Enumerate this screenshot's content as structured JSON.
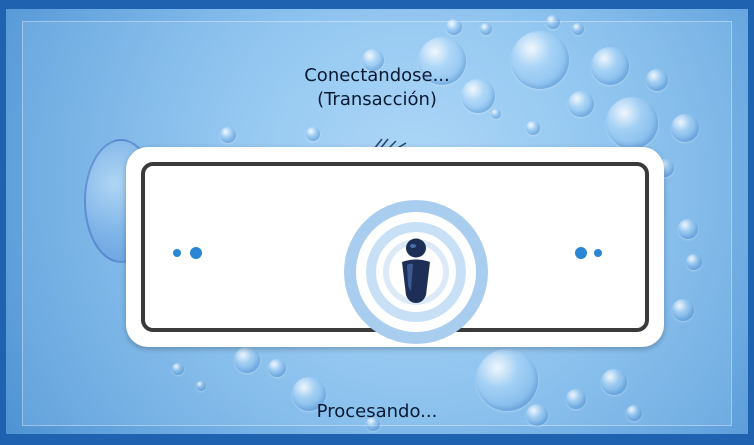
{
  "status": {
    "connecting_line1": "Conectandose...",
    "connecting_line2": "(Transacción)",
    "processing": "Procesando..."
  },
  "icons": {
    "center": "info-person-icon",
    "left_dots": "progress-dots-icon",
    "right_dots": "progress-dots-icon"
  },
  "colors": {
    "frame": "#1f63b0",
    "background": "#8fc4f0",
    "dialog_border": "#3a3a3a",
    "dot": "#2b86d6",
    "icon_dark": "#1d2f57",
    "ring_light": "#a9cdef"
  }
}
